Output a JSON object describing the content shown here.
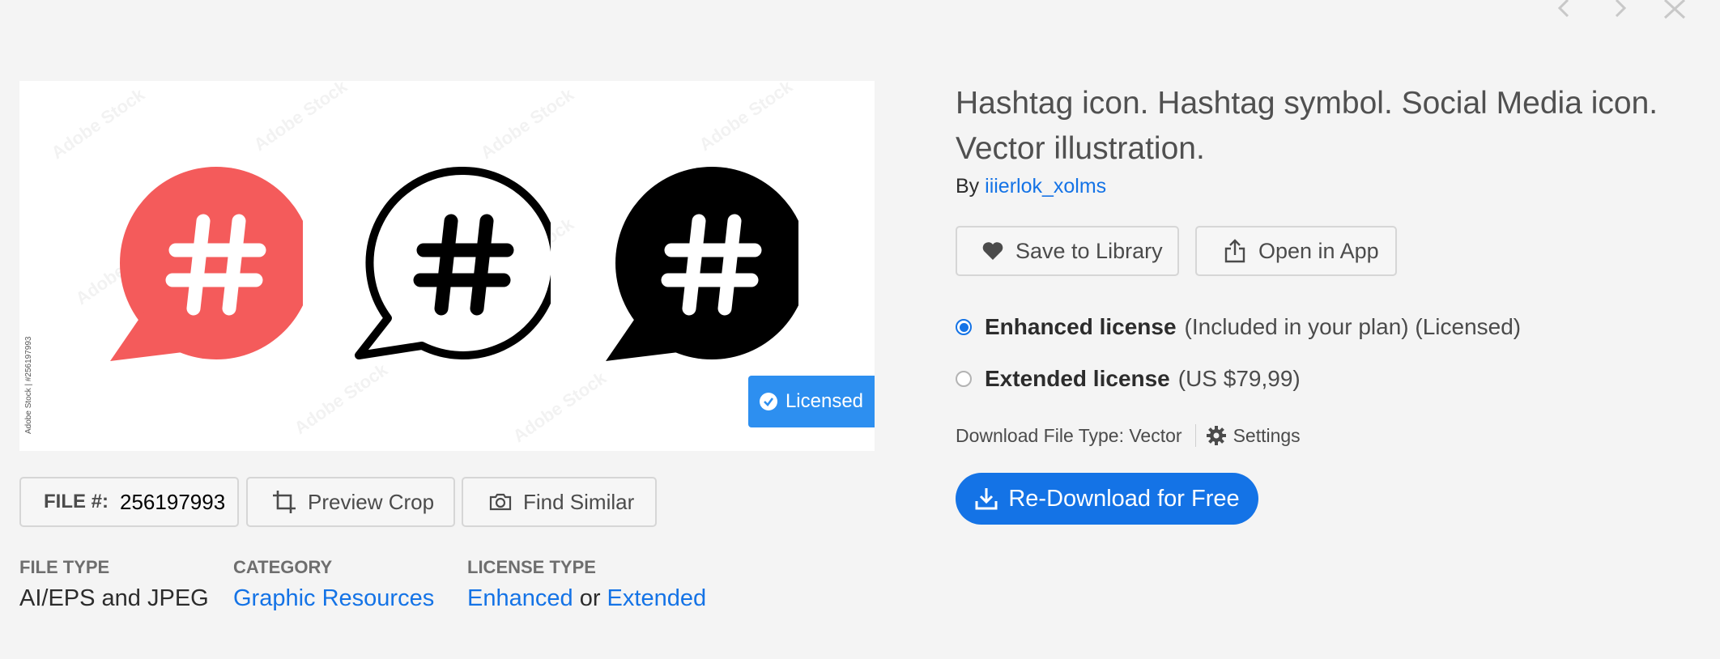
{
  "nav": {
    "prev_icon": "chevron-left-icon",
    "next_icon": "chevron-right-icon",
    "close_icon": "close-icon"
  },
  "preview": {
    "watermark": "Adobe Stock",
    "side_credit": "Adobe Stock | #256197993",
    "badge_label": "Licensed",
    "icons": [
      "hashtag-bubble-red-icon",
      "hashtag-bubble-outline-icon",
      "hashtag-bubble-black-icon"
    ],
    "colors": {
      "red": "#f45b5b",
      "black": "#000000",
      "badge": "#2d8ff0"
    }
  },
  "actions": {
    "file_label": "FILE #:",
    "file_number": "256197993",
    "preview_crop": "Preview Crop",
    "find_similar": "Find Similar"
  },
  "meta": {
    "file_type_label": "FILE TYPE",
    "file_type_value": "AI/EPS and JPEG",
    "category_label": "CATEGORY",
    "category_value": "Graphic Resources",
    "license_label": "LICENSE TYPE",
    "license_enhanced": "Enhanced",
    "license_or": "or",
    "license_extended": "Extended"
  },
  "asset": {
    "title": "Hashtag icon. Hashtag symbol. Social Media icon. Vector illustration.",
    "by": "By",
    "author": "iiierlok_xolms",
    "save_label": "Save to Library",
    "open_label": "Open in App"
  },
  "licenses": [
    {
      "name": "Enhanced license",
      "detail": "(Included in your plan) (Licensed)",
      "selected": true
    },
    {
      "name": "Extended license",
      "detail": "(US $79,99)",
      "selected": false
    }
  ],
  "download": {
    "file_type": "Download File Type: Vector",
    "settings": "Settings",
    "cta": "Re-Download for Free",
    "accent": "#1473e6"
  }
}
